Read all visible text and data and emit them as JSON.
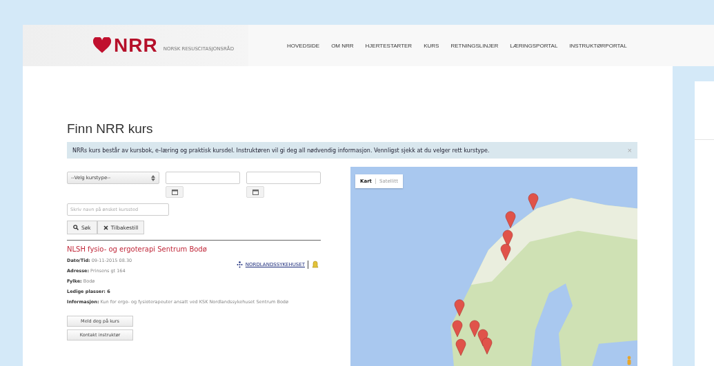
{
  "header": {
    "logo_text": "NRR",
    "logo_subtitle": "NORSK RESUSCITASJONSRÅD",
    "nav": [
      {
        "label": "HOVEDSIDE"
      },
      {
        "label": "OM NRR"
      },
      {
        "label": "HJERTESTARTER"
      },
      {
        "label": "KURS"
      },
      {
        "label": "RETNINGSLINJER"
      },
      {
        "label": "LÆRINGSPORTAL"
      },
      {
        "label": "INSTRUKTØRPORTAL"
      }
    ]
  },
  "page": {
    "title": "Finn NRR kurs",
    "alert": {
      "text": "NRRs kurs består av kursbok, e-læring og praktisk kursdel. Instruktøren vil gi deg all nødvendig informasjon. Vennligst sjekk at du velger rett kurstype.",
      "close": "×"
    }
  },
  "filters": {
    "course_type": "--Velg kurstype--",
    "location_placeholder": "Skriv navn på ønsket kurssted",
    "buttons": [
      {
        "label": "Søk",
        "kind": "search"
      },
      {
        "label": "Tilbakestill",
        "kind": "reset"
      }
    ]
  },
  "course": {
    "title": "NLSH fysio- og ergoterapi Sentrum Bodø",
    "organizer": "NORDLANDSSYKEHUSET",
    "details": [
      "**Dato/Tid:** 09-11-2015 08.30",
      "**Adresse:** Prinsens gt 164",
      "**Fylke:** Bodø",
      "**Ledige plasser: 6**",
      "**Informasjon:** Kun for ergo- og fysioterapeuter ansatt ved KSK Nordlandssykehuset Sentrum Bodø"
    ],
    "buttons": [
      "Meld deg på kurs",
      "Kontakt instruktør"
    ]
  },
  "map": {
    "map_types": [
      {
        "label": "Kart",
        "selected": true
      },
      {
        "label": "Satellitt",
        "selected": false
      }
    ]
  }
}
